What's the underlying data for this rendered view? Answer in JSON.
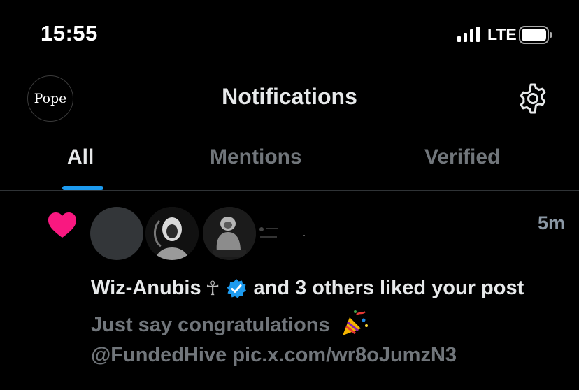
{
  "status_bar": {
    "time": "15:55",
    "network": "LTE",
    "icons": [
      "signal-icon",
      "battery-icon"
    ]
  },
  "header": {
    "avatar_text": "Pope",
    "title": "Notifications",
    "settings_icon": "gear-icon"
  },
  "tabs": [
    {
      "label": "All",
      "active": true
    },
    {
      "label": "Mentions",
      "active": false
    },
    {
      "label": "Verified",
      "active": false
    }
  ],
  "notification": {
    "icon": "heart-icon",
    "time_ago": "5m",
    "username": "Wiz-Anubis",
    "username_glyph": "☥",
    "verified_icon": "verified-badge-icon",
    "action_text": "and 3 others liked your post",
    "post_text": "Just say congratulations",
    "post_emoji_icon": "party-popper-icon",
    "post_mention": "@FundedHive",
    "post_link": "pic.x.com/wr8oJumzN3"
  },
  "colors": {
    "background": "#000000",
    "accent": "#1d9bf0",
    "heart": "#f91880",
    "muted": "#71767b",
    "text": "#e7e9ea"
  }
}
